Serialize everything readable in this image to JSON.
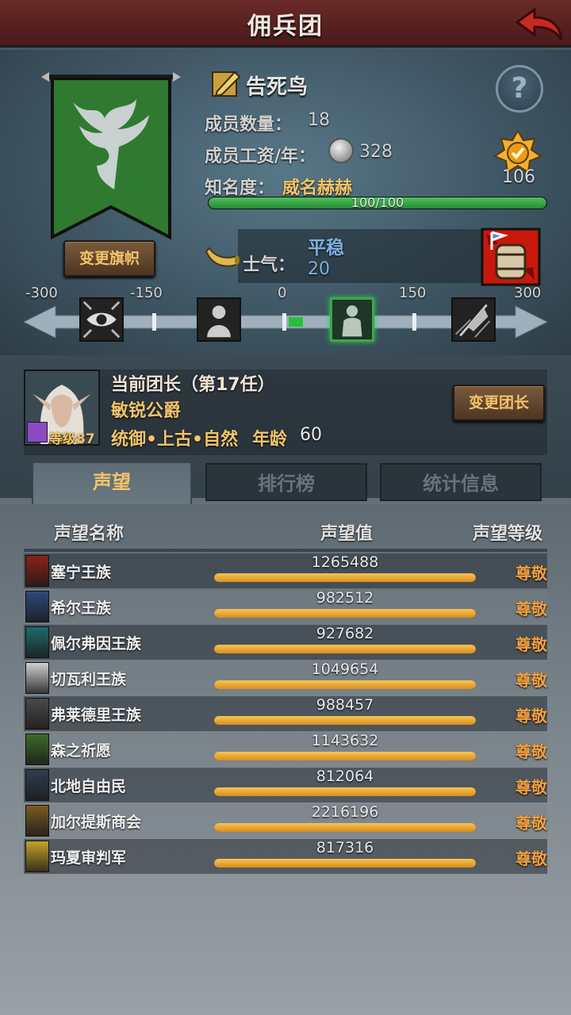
{
  "header": {
    "title": "佣兵团"
  },
  "guild": {
    "name": "告死鸟",
    "members_label": "成员数量：",
    "members": "18",
    "wage_label": "成员工资/年：",
    "wage": "328",
    "fame_label": "知名度：",
    "fame_level": "威名赫赫",
    "fame_progress": "100/100",
    "fame_fraction": 1.0,
    "rank": "106",
    "change_flag_label": "变更旗帜",
    "help_symbol": "?"
  },
  "morale": {
    "label": "士气：",
    "state": "平稳",
    "value": "20",
    "ticks": [
      "-300",
      "-150",
      "0",
      "150",
      "300"
    ],
    "icons": [
      "eye-icon",
      "sad-figure-icon",
      "calm-figure-icon",
      "battle-flag-icon"
    ]
  },
  "leader": {
    "title": "当前团长（第17任）",
    "name": "敏锐公爵",
    "level_label": "等级87",
    "attributes": "统御•上古•自然",
    "age_label": "年龄",
    "age": "60",
    "change_leader_label": "变更团长"
  },
  "tabs": [
    "声望",
    "排行榜",
    "统计信息"
  ],
  "reputation": {
    "col_name": "声望名称",
    "col_value": "声望值",
    "col_level": "声望等级",
    "rows": [
      {
        "name": "塞宁王族",
        "value": "1265488",
        "level": "尊敬",
        "color": "#8a2218"
      },
      {
        "name": "希尔王族",
        "value": "982512",
        "level": "尊敬",
        "color": "#2e4a78"
      },
      {
        "name": "佩尔弗因王族",
        "value": "927682",
        "level": "尊敬",
        "color": "#1d6a6a"
      },
      {
        "name": "切瓦利王族",
        "value": "1049654",
        "level": "尊敬",
        "color": "#cfcfcf"
      },
      {
        "name": "弗莱德里王族",
        "value": "988457",
        "level": "尊敬",
        "color": "#4a4a4a"
      },
      {
        "name": "森之祈愿",
        "value": "1143632",
        "level": "尊敬",
        "color": "#3e6a2a"
      },
      {
        "name": "北地自由民",
        "value": "812064",
        "level": "尊敬",
        "color": "#2e3e4e"
      },
      {
        "name": "加尔提斯商会",
        "value": "2216196",
        "level": "尊敬",
        "color": "#7a5a22"
      },
      {
        "name": "玛夏审判军",
        "value": "817316",
        "level": "尊敬",
        "color": "#c2a22a"
      }
    ]
  }
}
